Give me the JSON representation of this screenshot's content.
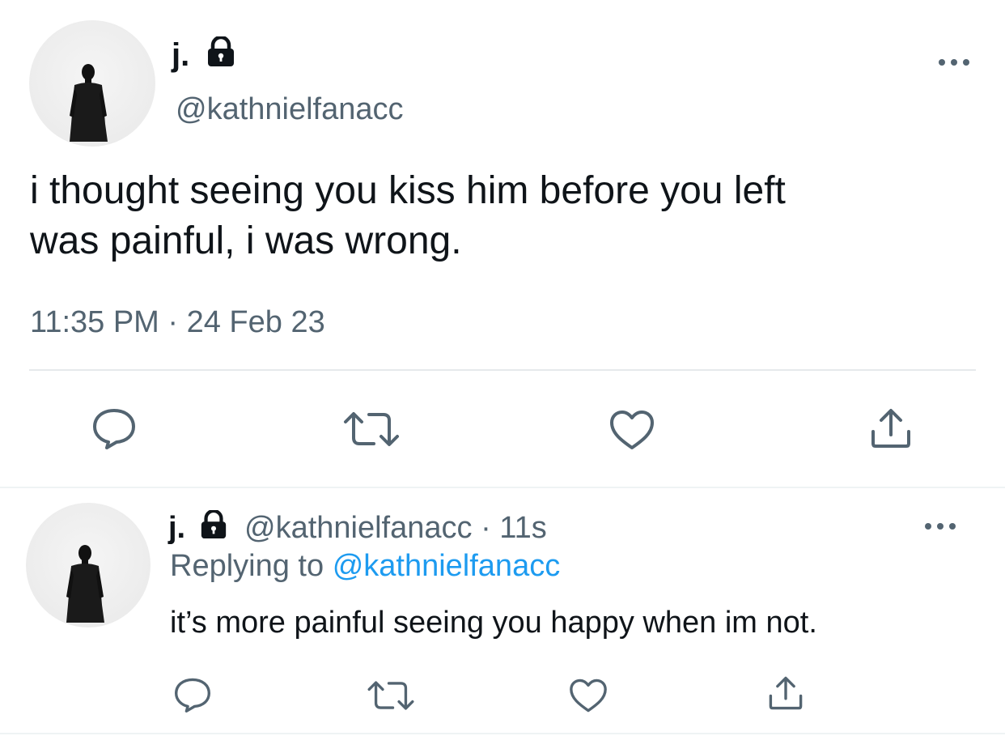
{
  "main_tweet": {
    "display_name": "j.",
    "handle": "@kathnielfanacc",
    "text_line1": "i thought seeing you kiss him before you left",
    "text_line2": "was painful, i was wrong.",
    "timestamp": "11:35 PM · 24 Feb 23"
  },
  "reply_tweet": {
    "display_name": "j.",
    "meta": "@kathnielfanacc · 11s",
    "replying_prefix": "Replying to",
    "replying_handle": "@kathnielfanacc",
    "text": "it’s more painful seeing you happy when im not."
  },
  "icons": [
    "lock-icon",
    "more-icon",
    "reply-icon",
    "retweet-icon",
    "like-icon",
    "share-icon"
  ],
  "colors": {
    "text": "#0f1419",
    "muted": "#536471",
    "link": "#1d9bf0",
    "divider": "#e6e9ec"
  }
}
